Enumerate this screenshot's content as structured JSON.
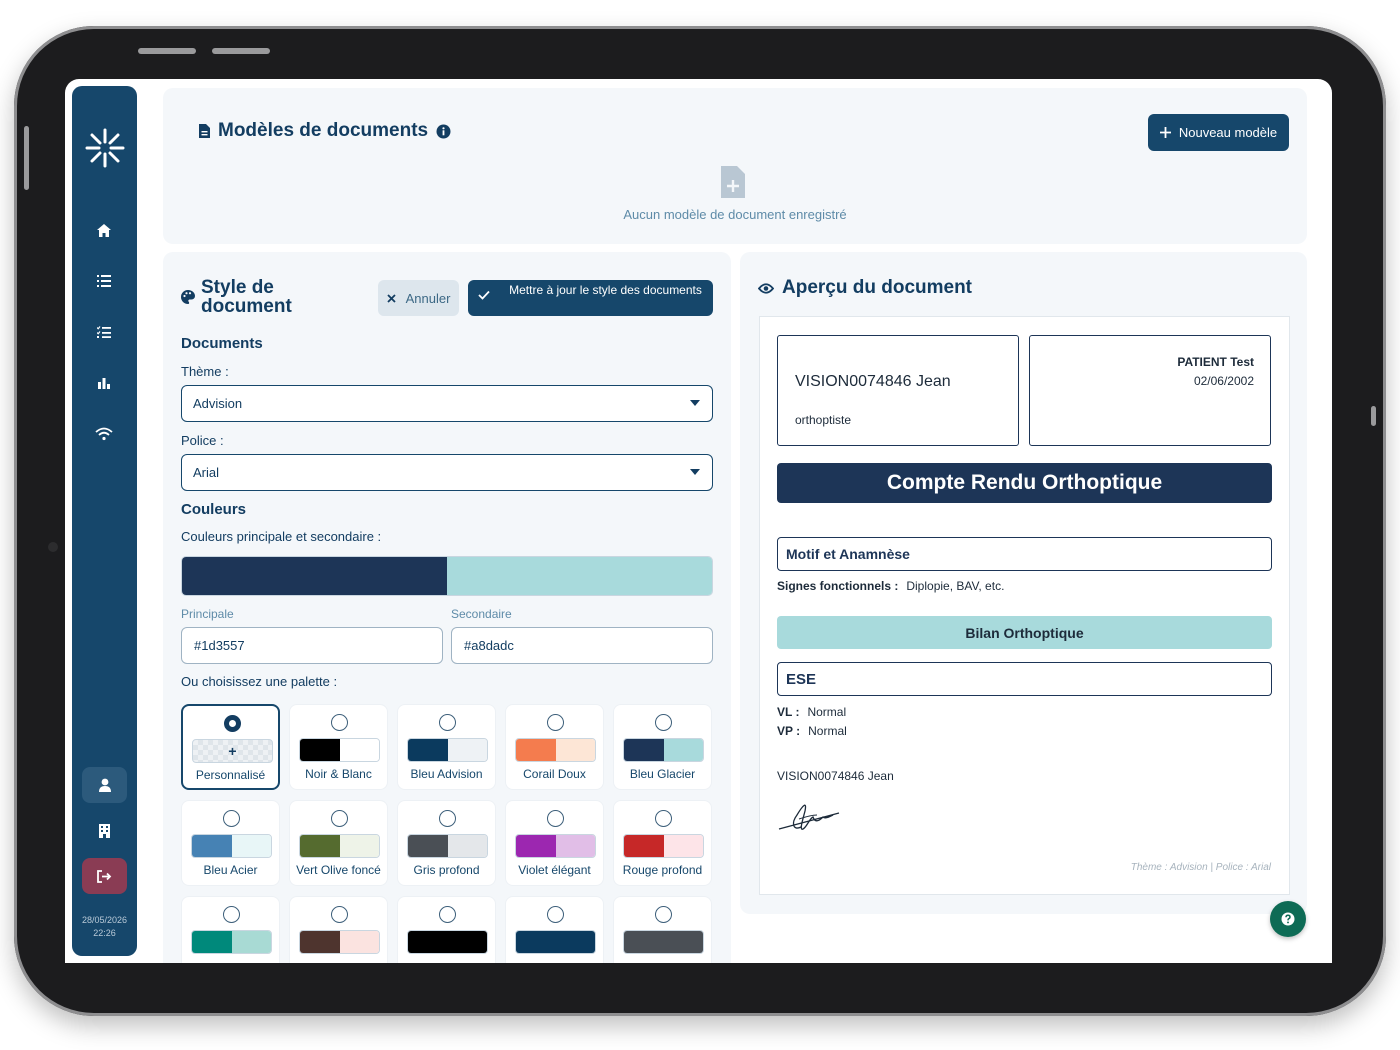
{
  "sidebar": {
    "nav": [
      "home-icon",
      "list-icon",
      "checklist-icon",
      "chart-icon",
      "wifi-icon",
      "user-icon",
      "building-icon",
      "logout-icon"
    ],
    "date": "28/05/2026",
    "time": "22:26"
  },
  "templates": {
    "title": "Modèles de documents",
    "new_button": "Nouveau modèle",
    "empty_text": "Aucun modèle de document enregistré"
  },
  "style": {
    "title": "Style de document",
    "cancel_button": "Annuler",
    "update_button": "Mettre à jour le style des documents",
    "documents_heading": "Documents",
    "theme_label": "Thème :",
    "theme_value": "Advision",
    "font_label": "Police :",
    "font_value": "Arial",
    "colors_heading": "Couleurs",
    "colors_label": "Couleurs principale et secondaire :",
    "primary_label": "Principale",
    "primary_value": "#1d3557",
    "secondary_label": "Secondaire",
    "secondary_value": "#a8dadc",
    "palette_label": "Ou choisissez une palette :",
    "palettes": [
      {
        "name": "Personnalisé",
        "c1": "",
        "c2": "",
        "selected": true
      },
      {
        "name": "Noir & Blanc",
        "c1": "#000000",
        "c2": "#ffffff"
      },
      {
        "name": "Bleu Advision",
        "c1": "#0b3a5e",
        "c2": "#eef2f5"
      },
      {
        "name": "Corail Doux",
        "c1": "#f47c4e",
        "c2": "#fde6d6"
      },
      {
        "name": "Bleu Glacier",
        "c1": "#1d3557",
        "c2": "#a8dadc"
      },
      {
        "name": "Bleu Acier",
        "c1": "#4682b4",
        "c2": "#e8f6f7"
      },
      {
        "name": "Vert Olive foncé",
        "c1": "#556b2f",
        "c2": "#eef3e8"
      },
      {
        "name": "Gris profond",
        "c1": "#4a4f55",
        "c2": "#e4e7ea"
      },
      {
        "name": "Violet élégant",
        "c1": "#9c27b0",
        "c2": "#e1bee7"
      },
      {
        "name": "Rouge profond",
        "c1": "#c62828",
        "c2": "#fde4e8"
      },
      {
        "name": "",
        "c1": "#00897b",
        "c2": "#a8dad4"
      },
      {
        "name": "",
        "c1": "#4e342e",
        "c2": "#fbe3e0"
      },
      {
        "name": "",
        "c1": "#000000",
        "c2": "#000000"
      },
      {
        "name": "",
        "c1": "#0b3a5e",
        "c2": "#0b3a5e"
      },
      {
        "name": "",
        "c1": "#4a4f55",
        "c2": "#4a4f55"
      }
    ]
  },
  "preview": {
    "title": "Aperçu du document",
    "doctor_name": "VISION0074846 Jean",
    "doctor_role": "orthoptiste",
    "patient_name": "PATIENT Test",
    "patient_dob": "02/06/2002",
    "report_title": "Compte Rendu Orthoptique",
    "section1": "Motif et Anamnèse",
    "signs_label": "Signes fonctionnels :",
    "signs_value": "Diplopie, BAV, etc.",
    "section2": "Bilan Orthoptique",
    "section3": "ESE",
    "vl_label": "VL :",
    "vl_value": "Normal",
    "vp_label": "VP :",
    "vp_value": "Normal",
    "signature_name": "VISION0074846 Jean",
    "footer": "Thème : Advision | Police : Arial"
  }
}
